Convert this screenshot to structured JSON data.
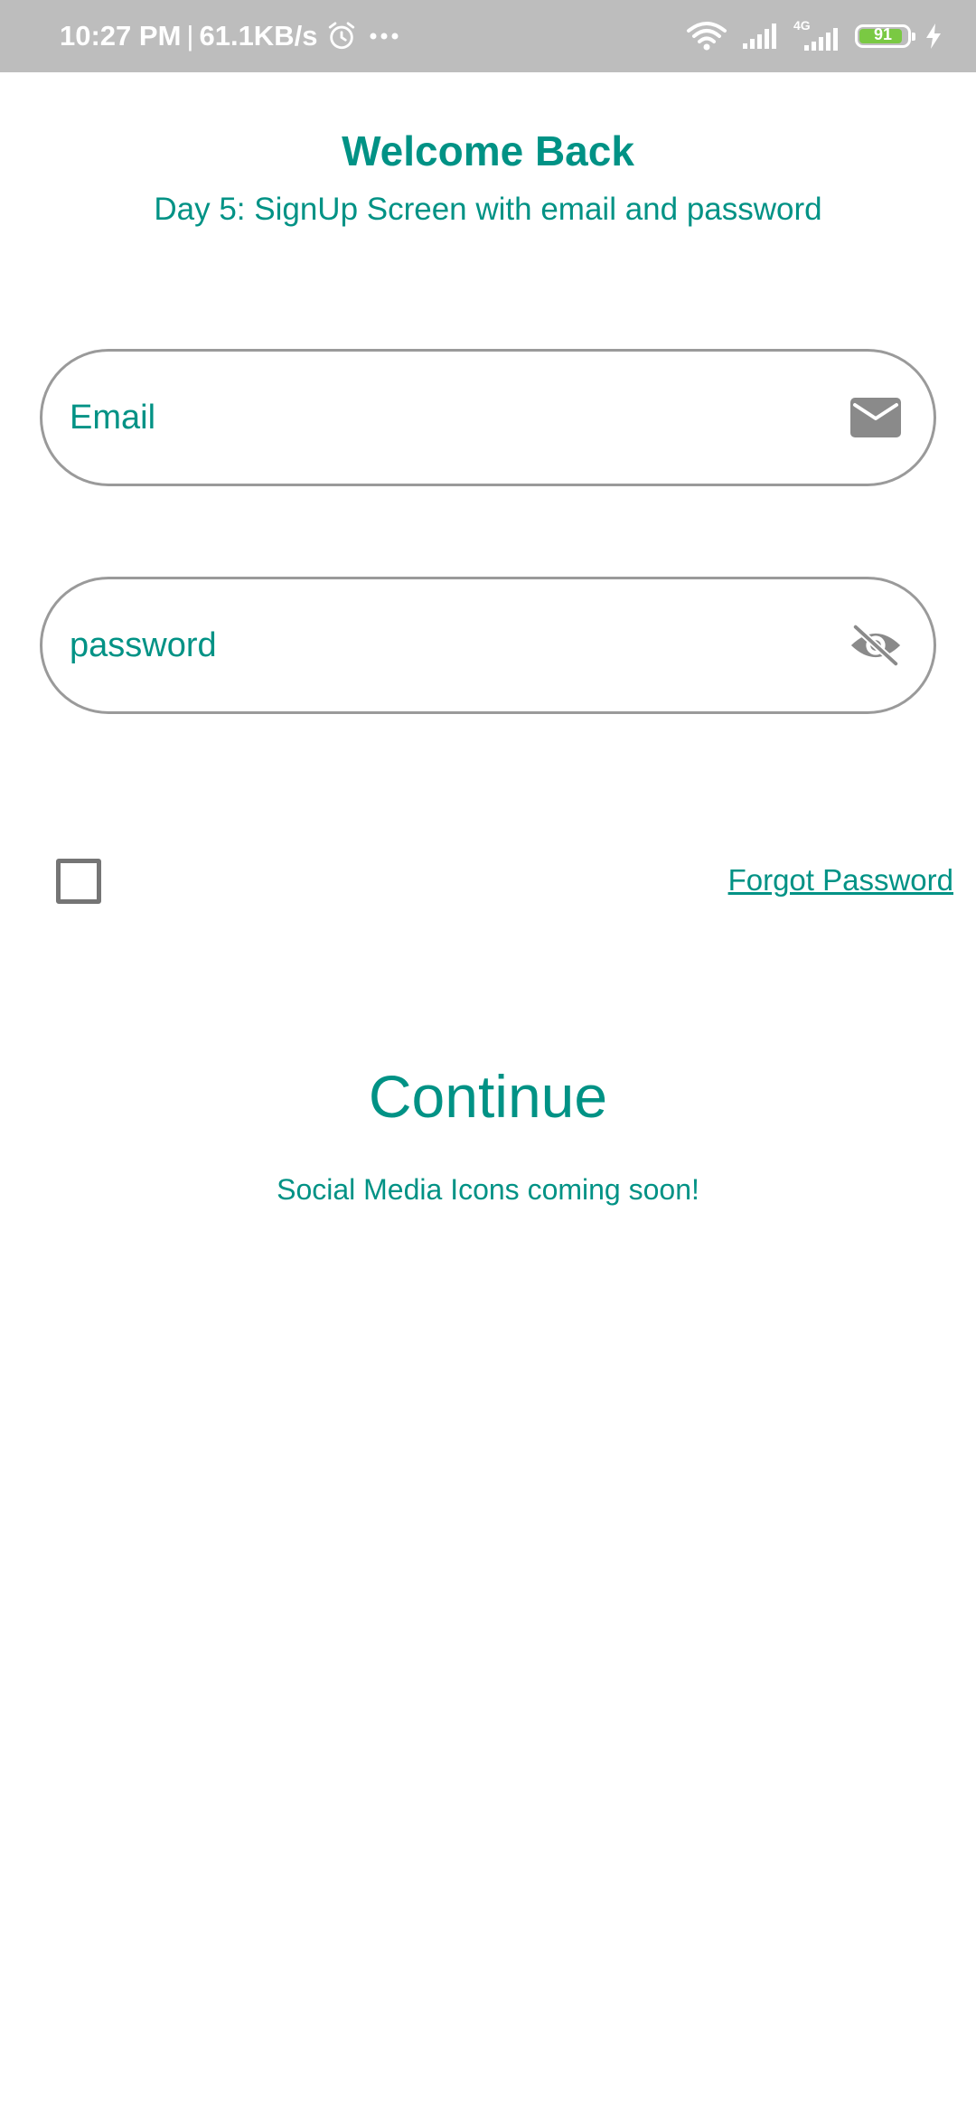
{
  "status_bar": {
    "time": "10:27 PM",
    "separator": "|",
    "network_speed": "61.1KB/s",
    "network_type": "4G",
    "battery_level": "91",
    "icons": [
      "alarm-icon",
      "more-dots-icon",
      "wifi-icon",
      "signal-icon",
      "signal-4g-icon",
      "battery-icon",
      "charging-icon"
    ],
    "background_color": "#bdbdbd",
    "battery_color": "#7ac943"
  },
  "header": {
    "title": "Welcome Back",
    "subtitle": "Day 5: SignUp Screen with email and password"
  },
  "form": {
    "email": {
      "placeholder": "Email",
      "value": "",
      "icon": "mail-icon"
    },
    "password": {
      "placeholder": "password",
      "value": "",
      "icon": "visibility-off-icon"
    },
    "remember_checked": false,
    "forgot_label": "Forgot Password",
    "continue_label": "Continue"
  },
  "footer": {
    "social_note": "Social Media Icons coming soon!"
  },
  "colors": {
    "accent": "#009285",
    "border": "#9a9a9a",
    "icon": "#8a8a8a"
  }
}
